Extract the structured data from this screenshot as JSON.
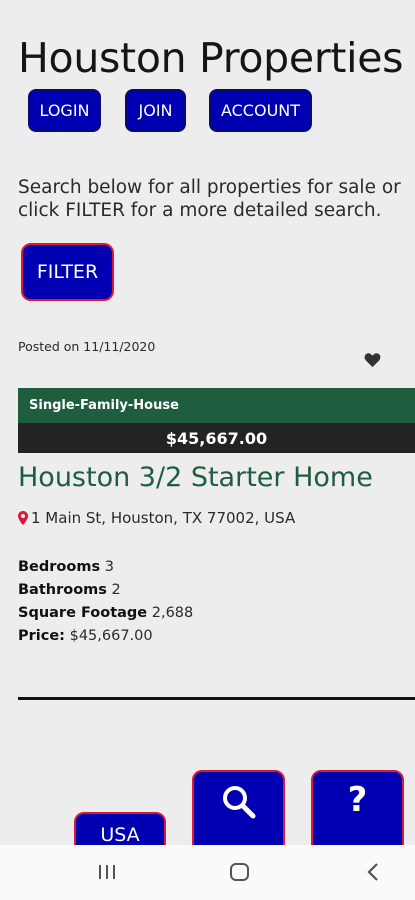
{
  "header": {
    "title": "Houston Properties"
  },
  "nav": {
    "login": "LOGIN",
    "join": "JOIN",
    "account": "ACCOUNT"
  },
  "intro_text_line1": "Search below for all properties for sale or",
  "intro_text_line2": "click FILTER for a more detailed search.",
  "filter_label": "FILTER",
  "listing": {
    "posted": "Posted on 11/11/2020",
    "type": "Single-Family-House",
    "price_banner": "$45,667.00",
    "title": "Houston 3/2 Starter Home",
    "address": "1 Main St, Houston, TX 77002, USA",
    "details": [
      {
        "label": "Bedrooms",
        "value": "3"
      },
      {
        "label": "Bathrooms",
        "value": "2"
      },
      {
        "label": "Square Footage",
        "value": "2,688"
      },
      {
        "label": "Price:",
        "value": "$45,667.00"
      }
    ]
  },
  "fabs": {
    "usa": "USA",
    "help": "?"
  },
  "icons": {
    "favorite": "heart-icon",
    "location": "map-pin-icon",
    "search": "search-icon"
  },
  "colors": {
    "button_blue": "#0000b3",
    "accent_red": "#d9183a",
    "listing_green": "#1e5e3f",
    "price_dark": "#232323"
  }
}
